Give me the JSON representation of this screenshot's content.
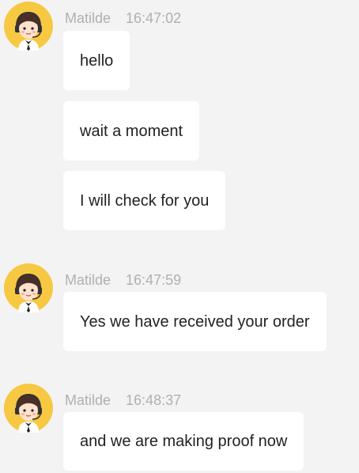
{
  "colors": {
    "background": "#f3f3f3",
    "bubble": "#ffffff",
    "meta_text": "#b0b0b0",
    "message_text": "#222222",
    "avatar_yellow": "#f7c842"
  },
  "chat": {
    "groups": [
      {
        "avatar_icon": "support-agent-avatar-icon",
        "sender": "Matilde",
        "time": "16:47:02",
        "messages": [
          "hello",
          "wait a moment",
          "I will check for you"
        ]
      },
      {
        "avatar_icon": "support-agent-avatar-icon",
        "sender": "Matilde",
        "time": "16:47:59",
        "messages": [
          "Yes we have received your order"
        ]
      },
      {
        "avatar_icon": "support-agent-avatar-icon",
        "sender": "Matilde",
        "time": "16:48:37",
        "messages": [
          "and we are making proof now"
        ]
      }
    ]
  }
}
